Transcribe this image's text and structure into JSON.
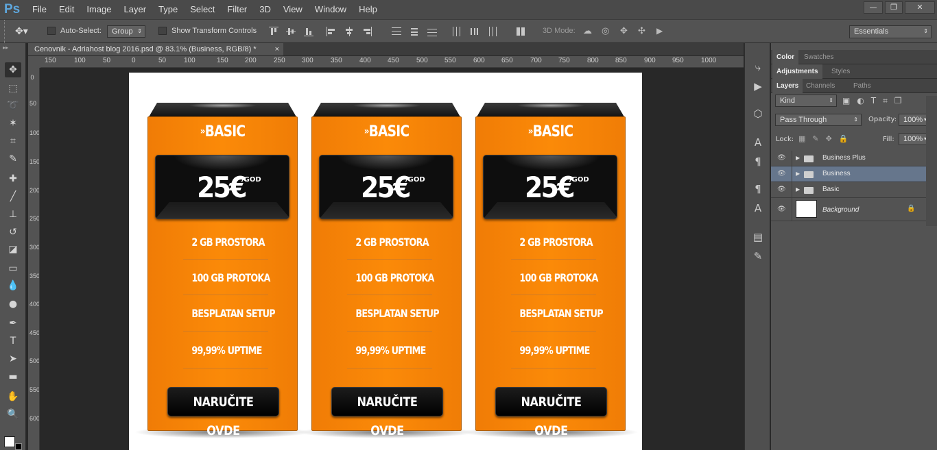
{
  "app": {
    "logo": "Ps",
    "menu": [
      "File",
      "Edit",
      "Image",
      "Layer",
      "Type",
      "Select",
      "Filter",
      "3D",
      "View",
      "Window",
      "Help"
    ],
    "win_controls": [
      "—",
      "❐",
      "✕"
    ]
  },
  "options": {
    "auto_select_label": "Auto-Select:",
    "auto_select_value": "Group",
    "transform_label": "Show Transform Controls",
    "mode_3d_label": "3D Mode:",
    "workspace": "Essentials"
  },
  "document": {
    "tab_title": "Cenovnik - Adriahost blog 2016.psd @ 83.1% (Business, RGB/8) *",
    "close": "×"
  },
  "rulers": {
    "h": [
      "150",
      "100",
      "50",
      "0",
      "50",
      "100",
      "150",
      "200",
      "250",
      "300",
      "350",
      "400",
      "450",
      "500",
      "550",
      "600",
      "650",
      "700",
      "750",
      "800",
      "850",
      "900",
      "950",
      "1000"
    ],
    "v": [
      "0",
      "50",
      "100",
      "150",
      "200",
      "250",
      "300",
      "350",
      "400",
      "450",
      "500",
      "550",
      "600"
    ]
  },
  "cards": [
    {
      "title_prefix": "»",
      "title": "BASIC",
      "price": "25€",
      "per": "/GOD",
      "features": [
        "2 GB PROSTORA",
        "100 GB PROTOKA",
        "BESPLATAN SETUP",
        "99,99% UPTIME"
      ],
      "button": "NARUČITE OVDE"
    },
    {
      "title_prefix": "»",
      "title": "BASIC",
      "price": "25€",
      "per": "/GOD",
      "features": [
        "2 GB PROSTORA",
        "100 GB PROTOKA",
        "BESPLATAN SETUP",
        "99,99% UPTIME"
      ],
      "button": "NARUČITE OVDE"
    },
    {
      "title_prefix": "»",
      "title": "BASIC",
      "price": "25€",
      "per": "/GOD",
      "features": [
        "2 GB PROSTORA",
        "100 GB PROTOKA",
        "BESPLATAN SETUP",
        "99,99% UPTIME"
      ],
      "button": "NARUČITE OVDE"
    }
  ],
  "panels": {
    "tabs1": [
      "Color",
      "Swatches"
    ],
    "tabs2": [
      "Adjustments",
      "Styles"
    ],
    "tabs3": [
      "Layers",
      "Channels",
      "Paths"
    ],
    "kind": "Kind",
    "blend": "Pass Through",
    "opacity_label": "Opacity:",
    "opacity": "100%",
    "lock_label": "Lock:",
    "fill_label": "Fill:",
    "fill": "100%",
    "layers": [
      {
        "name": "Business Plus",
        "type": "group",
        "selected": false
      },
      {
        "name": "Business",
        "type": "group",
        "selected": true
      },
      {
        "name": "Basic",
        "type": "group",
        "selected": false
      },
      {
        "name": "Background",
        "type": "image",
        "selected": false
      }
    ]
  },
  "colors": {
    "accent": "#f9880a",
    "selection": "#66768c"
  }
}
